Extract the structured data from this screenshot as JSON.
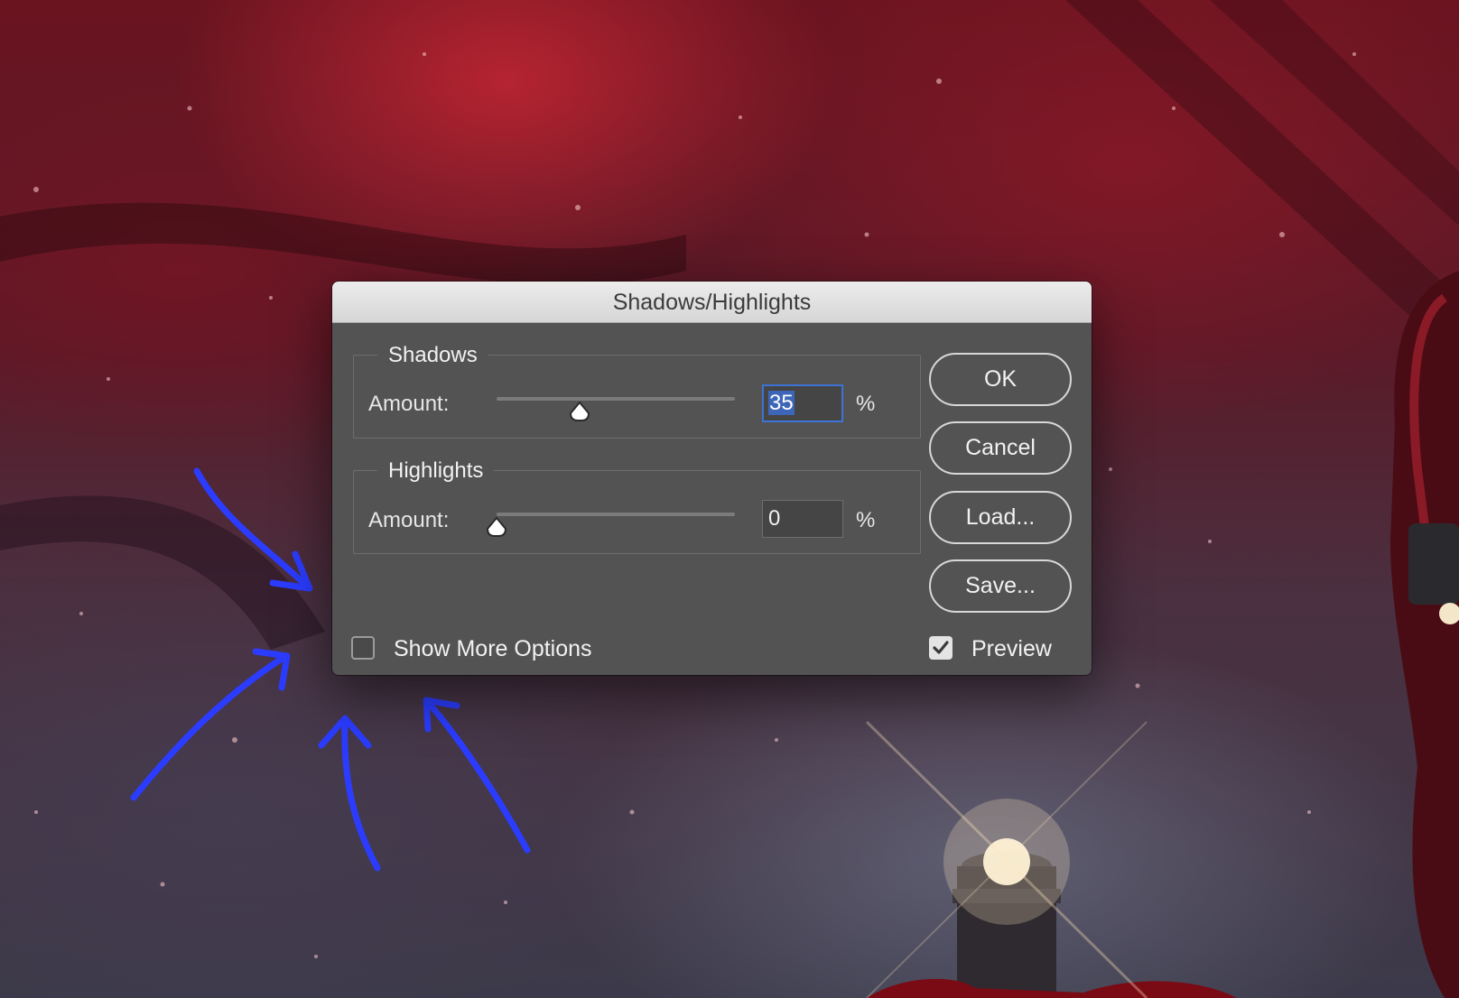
{
  "dialog": {
    "title": "Shadows/Highlights",
    "shadows": {
      "legend": "Shadows",
      "amount_label": "Amount:",
      "value": "35",
      "unit": "%",
      "slider_fraction": 0.35
    },
    "highlights": {
      "legend": "Highlights",
      "amount_label": "Amount:",
      "value": "0",
      "unit": "%",
      "slider_fraction": 0.0
    },
    "buttons": {
      "ok": "OK",
      "cancel": "Cancel",
      "load": "Load...",
      "save": "Save..."
    },
    "show_more_options": {
      "label": "Show More Options",
      "checked": false
    },
    "preview": {
      "label": "Preview",
      "checked": true
    }
  },
  "colors": {
    "dialog_bg": "#535353",
    "focus_ring": "#3d72d6",
    "annotation_arrows": "#2b3cff"
  },
  "annotations": {
    "arrow_count": 4,
    "icon": "hand-drawn-arrow-icon"
  }
}
